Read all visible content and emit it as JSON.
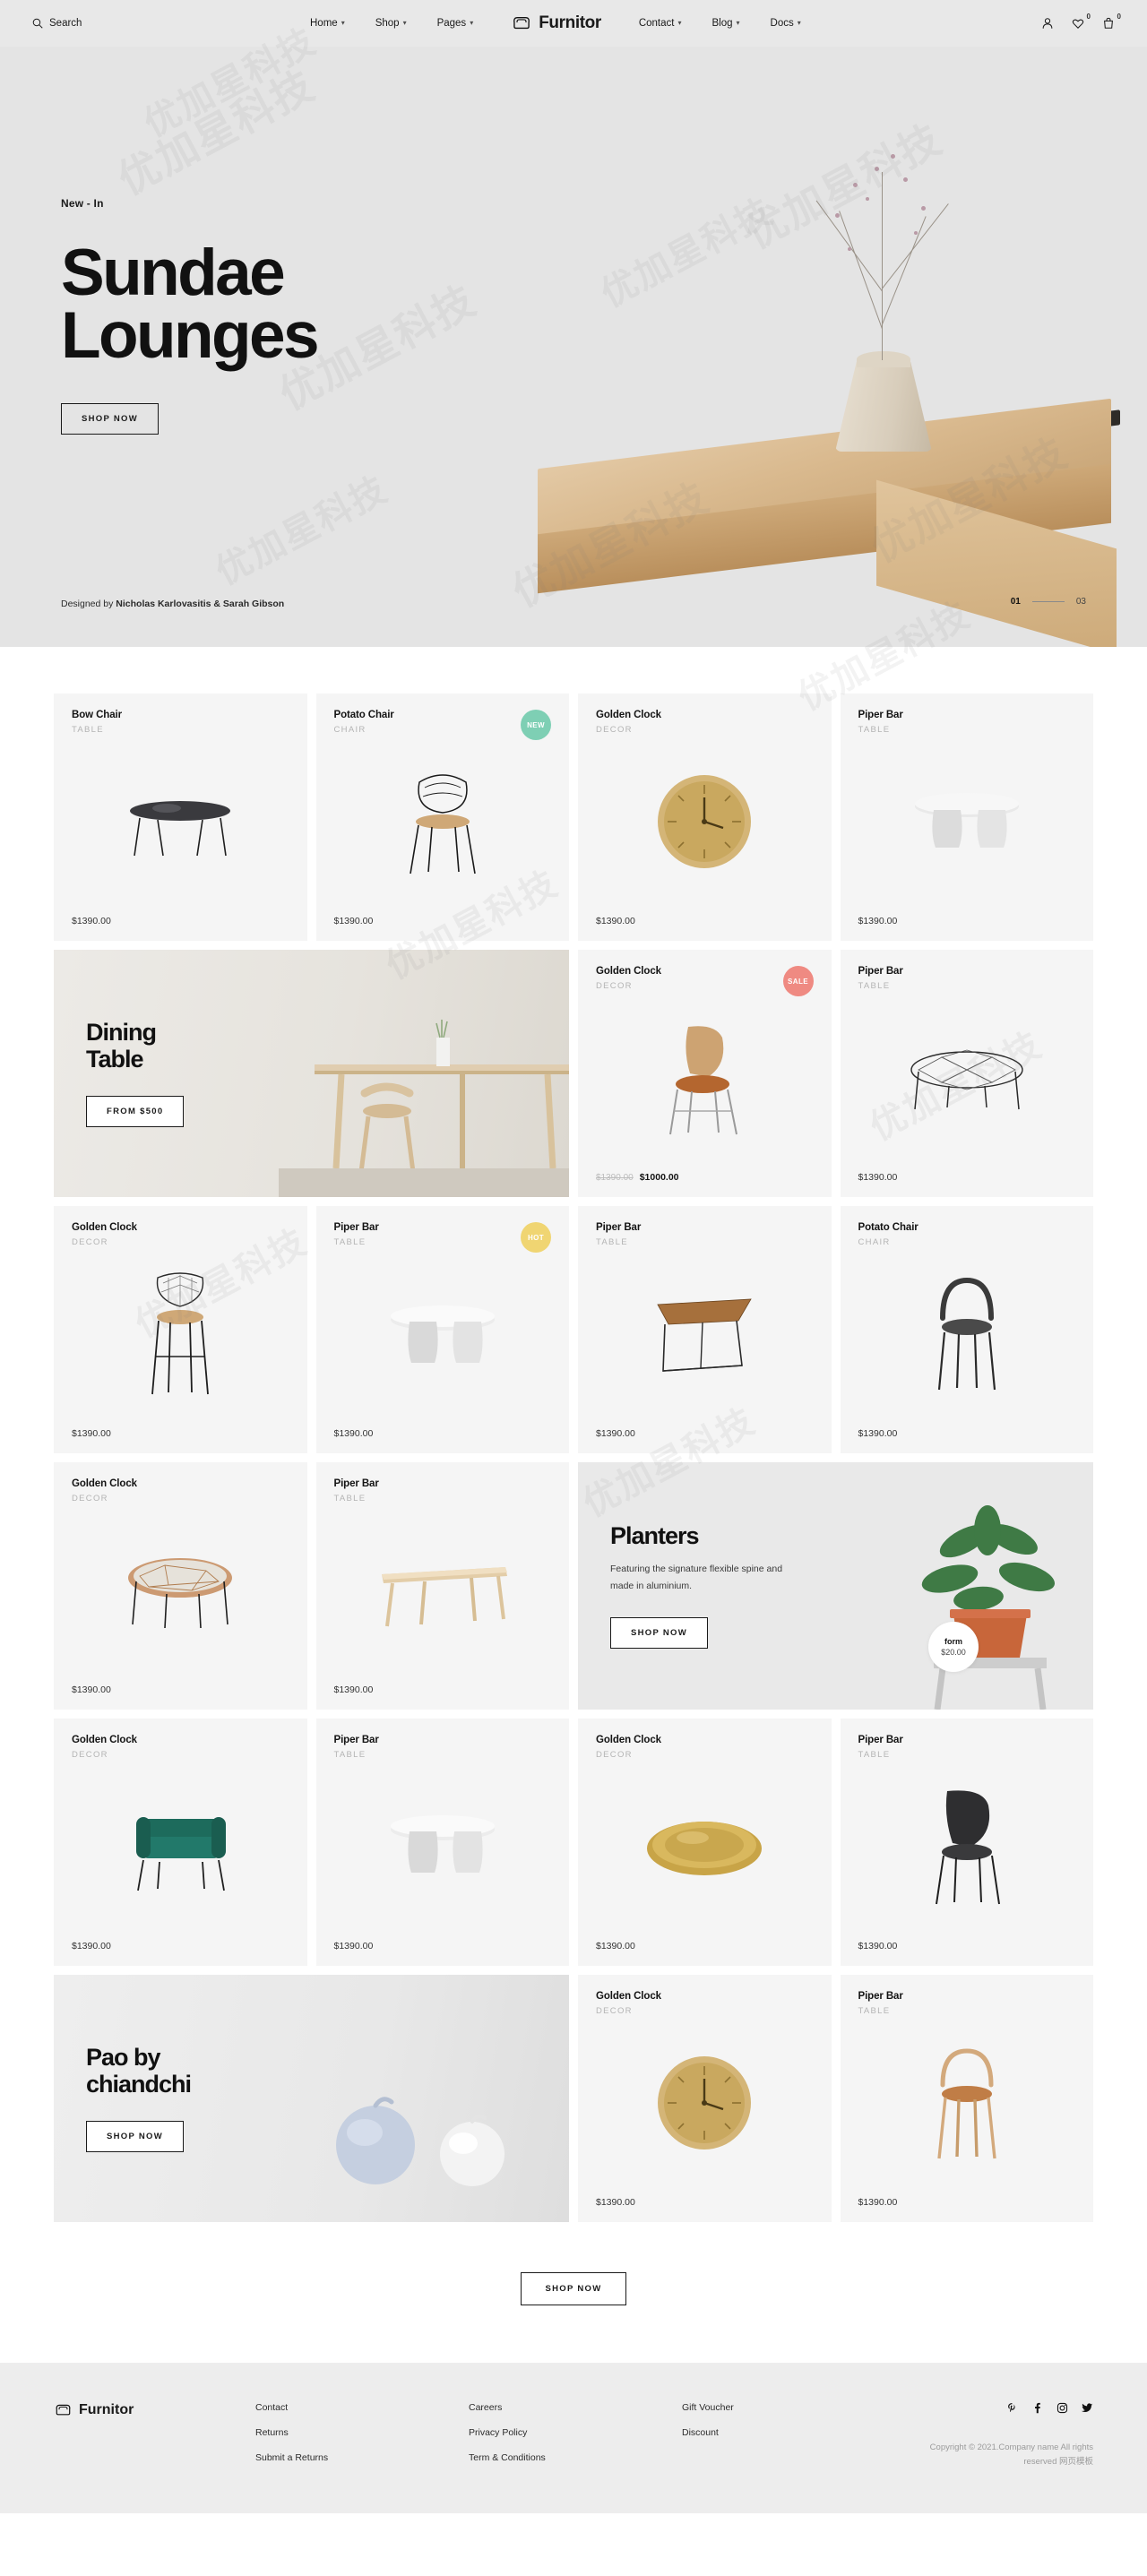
{
  "brand": {
    "name": "Furnitor",
    "logo_icon": "armchair-icon"
  },
  "header": {
    "search_label": "Search",
    "search_icon": "search-icon",
    "nav_left": [
      {
        "label": "Home",
        "has_caret": true
      },
      {
        "label": "Shop",
        "has_caret": true
      },
      {
        "label": "Pages",
        "has_caret": true
      }
    ],
    "nav_right": [
      {
        "label": "Contact",
        "has_caret": true
      },
      {
        "label": "Blog",
        "has_caret": true
      },
      {
        "label": "Docs",
        "has_caret": true
      }
    ],
    "icons": [
      {
        "name": "user-icon",
        "count": ""
      },
      {
        "name": "heart-icon",
        "count": "0"
      },
      {
        "name": "cart-icon",
        "count": "0"
      }
    ]
  },
  "hero": {
    "eyebrow": "New - In",
    "title_line1": "Sundae",
    "title_line2": "Lounges",
    "cta": "SHOP NOW",
    "credit_prefix": "Designed by ",
    "credit_names": "Nicholas Karlovasitis & Sarah Gibson",
    "slide_current": "01",
    "slide_total": "03"
  },
  "grid": {
    "row1": [
      {
        "kind": "product",
        "title": "Bow Chair",
        "category": "TABLE",
        "price": "$1390.00",
        "badge": "",
        "art": "bench-marble"
      },
      {
        "kind": "product",
        "title": "Potato Chair",
        "category": "CHAIR",
        "price": "$1390.00",
        "badge": "NEW",
        "badge_color": "#7ecfb4",
        "art": "wire-chair"
      },
      {
        "kind": "product",
        "title": "Golden Clock",
        "category": "DECOR",
        "price": "$1390.00",
        "badge": "",
        "art": "gold-clock"
      },
      {
        "kind": "product",
        "title": "Piper Bar",
        "category": "TABLE",
        "price": "$1390.00",
        "badge": "",
        "art": "round-table"
      }
    ],
    "row2_promo": {
      "kind": "promo",
      "title_line1": "Dining",
      "title_line2": "Table",
      "cta": "FROM $500"
    },
    "row2": [
      {
        "kind": "product",
        "title": "Golden Clock",
        "category": "DECOR",
        "price_old": "$1390.00",
        "price": "$1000.00",
        "badge": "SALE",
        "badge_color": "#ef8a82",
        "art": "tan-chair"
      },
      {
        "kind": "product",
        "title": "Piper Bar",
        "category": "TABLE",
        "price": "$1390.00",
        "badge": "",
        "art": "wire-bench"
      }
    ],
    "row3": [
      {
        "kind": "product",
        "title": "Golden Clock",
        "category": "DECOR",
        "price": "$1390.00",
        "badge": "",
        "art": "bar-stool"
      },
      {
        "kind": "product",
        "title": "Piper Bar",
        "category": "TABLE",
        "price": "$1390.00",
        "badge": "HOT",
        "badge_color": "#f0d572",
        "art": "twin-table"
      },
      {
        "kind": "product",
        "title": "Piper Bar",
        "category": "TABLE",
        "price": "$1390.00",
        "badge": "",
        "art": "wedge-table"
      },
      {
        "kind": "product",
        "title": "Potato Chair",
        "category": "CHAIR",
        "price": "$1390.00",
        "badge": "",
        "art": "black-stool"
      }
    ],
    "row4": [
      {
        "kind": "product",
        "title": "Golden Clock",
        "category": "DECOR",
        "price": "$1390.00",
        "badge": "",
        "art": "lattice-table"
      },
      {
        "kind": "product",
        "title": "Piper Bar",
        "category": "TABLE",
        "price": "$1390.00",
        "badge": "",
        "art": "wood-desk"
      }
    ],
    "row4_promo": {
      "kind": "promo",
      "title_line1": "Planters",
      "title_line2": "",
      "subtitle": "Featuring the signature flexible spine and made in aluminium.",
      "cta": "SHOP NOW",
      "bubble_name": "form",
      "bubble_price": "$20.00"
    },
    "row5": [
      {
        "kind": "product",
        "title": "Golden Clock",
        "category": "DECOR",
        "price": "$1390.00",
        "badge": "",
        "art": "green-sofa"
      },
      {
        "kind": "product",
        "title": "Piper Bar",
        "category": "TABLE",
        "price": "$1390.00",
        "badge": "",
        "art": "twin-table"
      },
      {
        "kind": "product",
        "title": "Golden Clock",
        "category": "DECOR",
        "price": "$1390.00",
        "badge": "",
        "art": "brass-tray"
      },
      {
        "kind": "product",
        "title": "Piper Bar",
        "category": "TABLE",
        "price": "$1390.00",
        "badge": "",
        "art": "black-chair"
      }
    ],
    "row6_promo": {
      "kind": "promo",
      "title_line1": "Pao by",
      "title_line2": "chiandchi",
      "cta": "SHOP NOW"
    },
    "row6": [
      {
        "kind": "product",
        "title": "Golden Clock",
        "category": "DECOR",
        "price": "$1390.00",
        "badge": "",
        "art": "gold-clock"
      },
      {
        "kind": "product",
        "title": "Piper Bar",
        "category": "TABLE",
        "price": "$1390.00",
        "badge": "",
        "art": "wood-stool"
      }
    ]
  },
  "bottom_cta": {
    "label": "SHOP NOW"
  },
  "footer": {
    "col1": [
      "Contact",
      "Returns",
      "Submit a Returns"
    ],
    "col2": [
      "Careers",
      "Privacy Policy",
      "Term & Conditions"
    ],
    "col3": [
      "Gift Voucher",
      "Discount"
    ],
    "social": [
      "pinterest-icon",
      "facebook-icon",
      "instagram-icon",
      "twitter-icon"
    ],
    "copyright": "Copyright © 2021.Company name All rights reserved 网页模板"
  },
  "watermark": {
    "text": "优加星科技"
  }
}
